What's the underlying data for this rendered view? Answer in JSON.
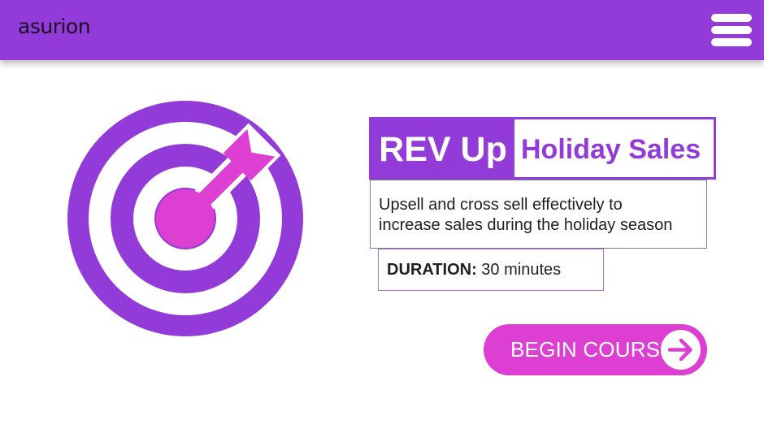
{
  "header": {
    "logo_text": "asurion",
    "menu_icon": "hamburger-menu-icon",
    "background_color": "#923bd9"
  },
  "hero_icon": "bullseye-target-arrow-icon",
  "course": {
    "title_primary": "REV Up",
    "title_secondary": "Holiday Sales",
    "description_line1": "Upsell and cross sell effectively to",
    "description_line2": "increase sales during the holiday season",
    "duration_label": "DURATION:",
    "duration_value": "30 minutes"
  },
  "begin_button": {
    "label": "BEGIN COURSE",
    "icon": "arrow-right-circle-icon"
  },
  "colors": {
    "purple": "#923bd9",
    "magenta": "#dc3fd2",
    "white": "#ffffff"
  }
}
